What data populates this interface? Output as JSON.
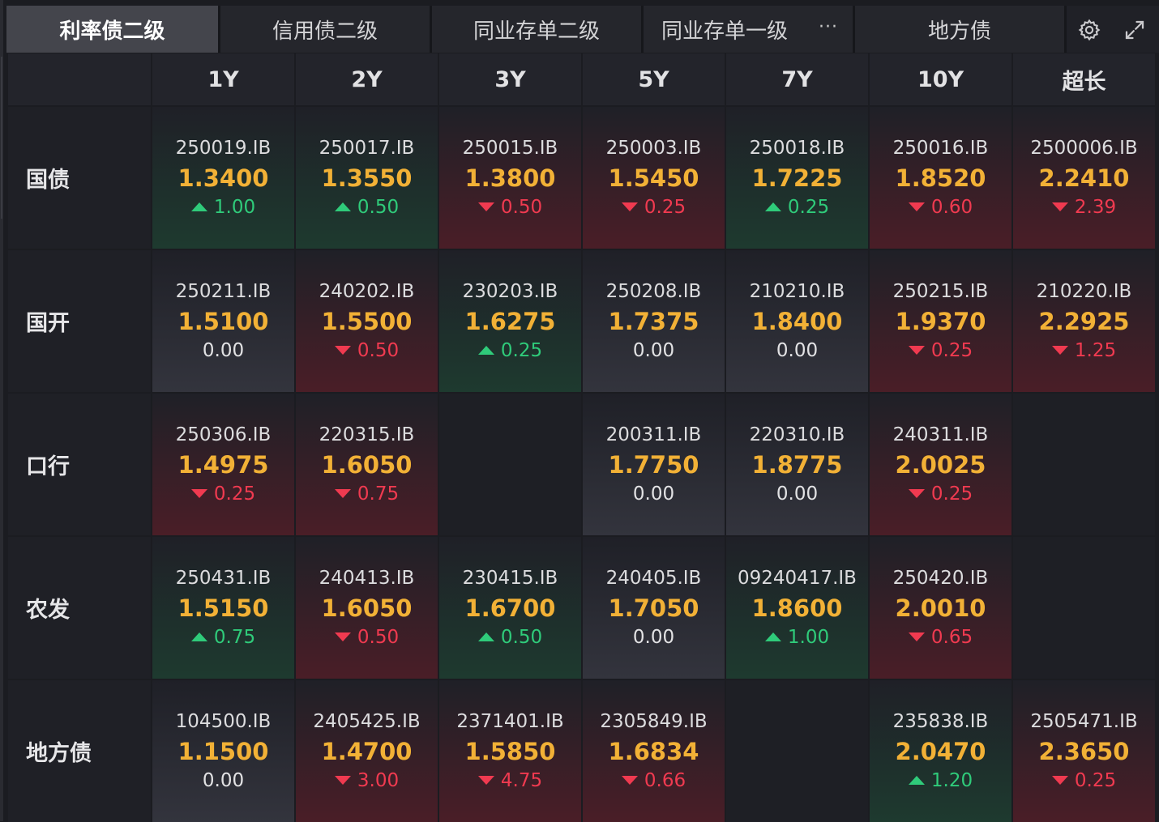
{
  "tabs": [
    {
      "label": "利率债二级",
      "active": true
    },
    {
      "label": "信用债二级",
      "active": false
    },
    {
      "label": "同业存单二级",
      "active": false
    },
    {
      "label": "同业存单一级",
      "active": false
    },
    {
      "label": "地方债",
      "active": false
    }
  ],
  "more_icon": "···",
  "toolbar": {
    "settings_icon": "gear-icon",
    "expand_icon": "expand-icon"
  },
  "columns": [
    "1Y",
    "2Y",
    "3Y",
    "5Y",
    "7Y",
    "10Y",
    "超长"
  ],
  "colors": {
    "up": "#2fcb7a",
    "down": "#f03a50",
    "yield": "#f2b136"
  },
  "rows": [
    {
      "label": "国债",
      "cells": [
        {
          "code": "250019.IB",
          "yield": "1.3400",
          "change": "1.00",
          "dir": "up"
        },
        {
          "code": "250017.IB",
          "yield": "1.3550",
          "change": "0.50",
          "dir": "up"
        },
        {
          "code": "250015.IB",
          "yield": "1.3800",
          "change": "0.50",
          "dir": "down"
        },
        {
          "code": "250003.IB",
          "yield": "1.5450",
          "change": "0.25",
          "dir": "down"
        },
        {
          "code": "250018.IB",
          "yield": "1.7225",
          "change": "0.25",
          "dir": "up"
        },
        {
          "code": "250016.IB",
          "yield": "1.8520",
          "change": "0.60",
          "dir": "down"
        },
        {
          "code": "2500006.IB",
          "yield": "2.2410",
          "change": "2.39",
          "dir": "down"
        }
      ]
    },
    {
      "label": "国开",
      "cells": [
        {
          "code": "250211.IB",
          "yield": "1.5100",
          "change": "0.00",
          "dir": "flat"
        },
        {
          "code": "240202.IB",
          "yield": "1.5500",
          "change": "0.50",
          "dir": "down"
        },
        {
          "code": "230203.IB",
          "yield": "1.6275",
          "change": "0.25",
          "dir": "up"
        },
        {
          "code": "250208.IB",
          "yield": "1.7375",
          "change": "0.00",
          "dir": "flat"
        },
        {
          "code": "210210.IB",
          "yield": "1.8400",
          "change": "0.00",
          "dir": "flat"
        },
        {
          "code": "250215.IB",
          "yield": "1.9370",
          "change": "0.25",
          "dir": "down"
        },
        {
          "code": "210220.IB",
          "yield": "2.2925",
          "change": "1.25",
          "dir": "down"
        }
      ]
    },
    {
      "label": "口行",
      "cells": [
        {
          "code": "250306.IB",
          "yield": "1.4975",
          "change": "0.25",
          "dir": "down"
        },
        {
          "code": "220315.IB",
          "yield": "1.6050",
          "change": "0.75",
          "dir": "down"
        },
        null,
        {
          "code": "200311.IB",
          "yield": "1.7750",
          "change": "0.00",
          "dir": "flat"
        },
        {
          "code": "220310.IB",
          "yield": "1.8775",
          "change": "0.00",
          "dir": "flat"
        },
        {
          "code": "240311.IB",
          "yield": "2.0025",
          "change": "0.25",
          "dir": "down"
        },
        null
      ]
    },
    {
      "label": "农发",
      "cells": [
        {
          "code": "250431.IB",
          "yield": "1.5150",
          "change": "0.75",
          "dir": "up"
        },
        {
          "code": "240413.IB",
          "yield": "1.6050",
          "change": "0.50",
          "dir": "down"
        },
        {
          "code": "230415.IB",
          "yield": "1.6700",
          "change": "0.50",
          "dir": "up"
        },
        {
          "code": "240405.IB",
          "yield": "1.7050",
          "change": "0.00",
          "dir": "flat"
        },
        {
          "code": "09240417.IB",
          "yield": "1.8600",
          "change": "1.00",
          "dir": "up"
        },
        {
          "code": "250420.IB",
          "yield": "2.0010",
          "change": "0.65",
          "dir": "down"
        },
        null
      ]
    },
    {
      "label": "地方债",
      "cells": [
        {
          "code": "104500.IB",
          "yield": "1.1500",
          "change": "0.00",
          "dir": "flat"
        },
        {
          "code": "2405425.IB",
          "yield": "1.4700",
          "change": "3.00",
          "dir": "down"
        },
        {
          "code": "2371401.IB",
          "yield": "1.5850",
          "change": "4.75",
          "dir": "down"
        },
        {
          "code": "2305849.IB",
          "yield": "1.6834",
          "change": "0.66",
          "dir": "down"
        },
        null,
        {
          "code": "235838.IB",
          "yield": "2.0470",
          "change": "1.20",
          "dir": "up"
        },
        {
          "code": "2505471.IB",
          "yield": "2.3650",
          "change": "0.25",
          "dir": "down"
        }
      ]
    }
  ]
}
